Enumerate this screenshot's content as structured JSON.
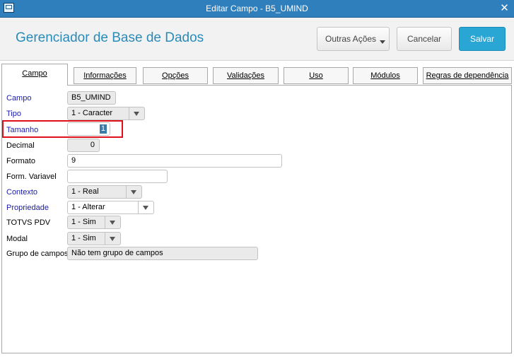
{
  "window": {
    "title": "Editar Campo - B5_UMIND",
    "close_glyph": "✕"
  },
  "header": {
    "title": "Gerenciador de Base de Dados"
  },
  "actions": {
    "more_label": "Outras Ações",
    "cancel_label": "Cancelar",
    "save_label": "Salvar"
  },
  "tabs": [
    "Campo",
    "Informações",
    "Opções",
    "Validações",
    "Uso",
    "Módulos",
    "Regras de dependência"
  ],
  "fields": {
    "campo": {
      "label": "Campo",
      "value": "B5_UMIND"
    },
    "tipo": {
      "label": "Tipo",
      "value": "1 - Caracter"
    },
    "tamanho": {
      "label": "Tamanho",
      "value": "1"
    },
    "decimal": {
      "label": "Decimal",
      "value": "0"
    },
    "formato": {
      "label": "Formato",
      "value": "9"
    },
    "form_variavel": {
      "label": "Form. Variavel",
      "value": ""
    },
    "contexto": {
      "label": "Contexto",
      "value": "1 - Real"
    },
    "propriedade": {
      "label": "Propriedade",
      "value": "1 - Alterar"
    },
    "totvs_pdv": {
      "label": "TOTVS PDV",
      "value": "1 - Sim"
    },
    "modal": {
      "label": "Modal",
      "value": "1 - Sim"
    },
    "grupo_campos": {
      "label": "Grupo de campos",
      "value": "Não tem grupo de campos"
    }
  },
  "colors": {
    "title_bar": "#2f7fbd",
    "heading": "#2a8bb8",
    "save_button": "#2aa6d4",
    "required_label": "#1a1ab2",
    "highlight": "#e0101b"
  }
}
